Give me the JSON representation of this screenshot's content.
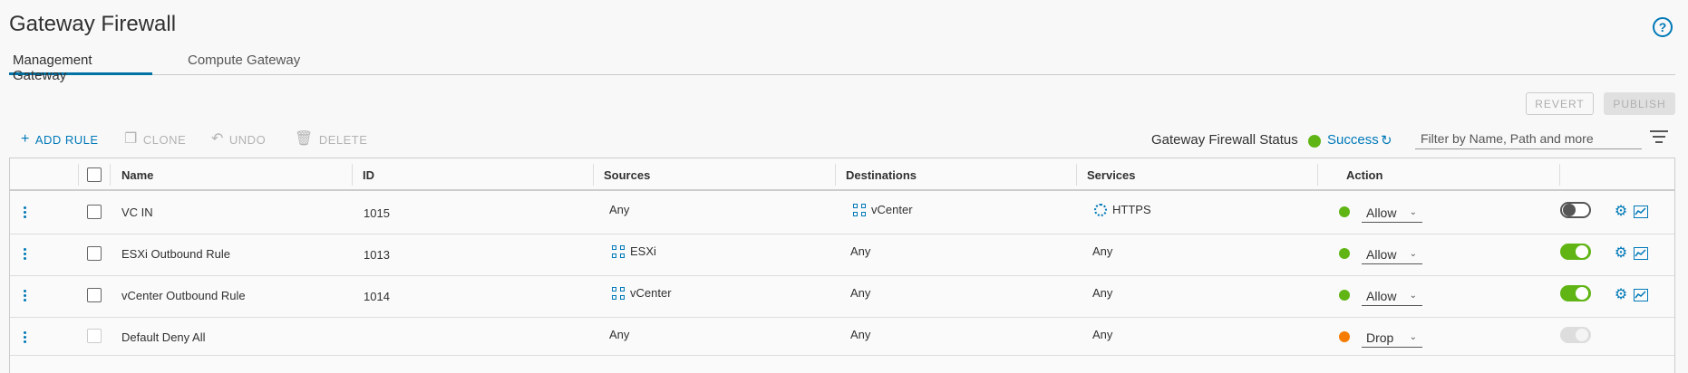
{
  "page": {
    "title": "Gateway Firewall"
  },
  "tabs": [
    {
      "label": "Management Gateway"
    },
    {
      "label": "Compute Gateway"
    }
  ],
  "buttons": {
    "revert": "REVERT",
    "publish": "PUBLISH"
  },
  "toolbar": {
    "add_rule": "ADD RULE",
    "clone": "CLONE",
    "undo": "UNDO",
    "delete": "DELETE"
  },
  "status": {
    "label": "Gateway Firewall Status",
    "value": "Success",
    "color": "#60b515"
  },
  "filter": {
    "placeholder": "Filter by Name, Path and more"
  },
  "columns": {
    "name": "Name",
    "id": "ID",
    "sources": "Sources",
    "destinations": "Destinations",
    "services": "Services",
    "action": "Action"
  },
  "rows": [
    {
      "name": "VC IN",
      "id": "1015",
      "sources": "Any",
      "destinations": "vCenter",
      "services": "HTTPS",
      "action": "Allow",
      "enabled": false
    },
    {
      "name": "ESXi Outbound Rule",
      "id": "1013",
      "sources": "ESXi",
      "destinations": "Any",
      "services": "Any",
      "action": "Allow",
      "enabled": true
    },
    {
      "name": "vCenter Outbound Rule",
      "id": "1014",
      "sources": "vCenter",
      "destinations": "Any",
      "services": "Any",
      "action": "Allow",
      "enabled": true
    },
    {
      "name": "Default Deny All",
      "id": "",
      "sources": "Any",
      "destinations": "Any",
      "services": "Any",
      "action": "Drop",
      "enabled": true
    }
  ],
  "colors": {
    "accent": "#0079b8",
    "allow": "#60b515",
    "drop": "#f57c00"
  }
}
